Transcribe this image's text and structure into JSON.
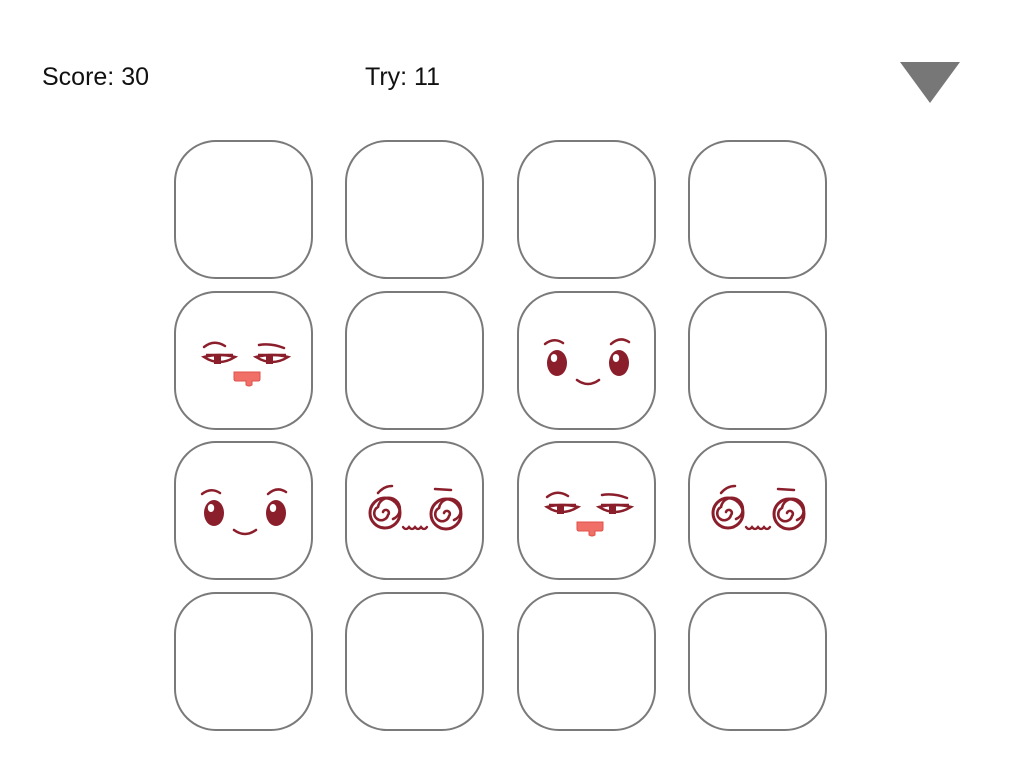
{
  "hud": {
    "score_label": "Score: 30",
    "try_label": "Try: 11"
  },
  "menu": {
    "icon": "triangle-down-icon",
    "color": "#777777"
  },
  "colors": {
    "face_dark": "#8b1e2b",
    "tongue": "#f07068",
    "card_border": "#7a7a7a"
  },
  "board": {
    "rows": 4,
    "cols": 4,
    "cards": [
      {
        "state": "hidden",
        "face": ""
      },
      {
        "state": "hidden",
        "face": ""
      },
      {
        "state": "hidden",
        "face": ""
      },
      {
        "state": "hidden",
        "face": ""
      },
      {
        "state": "revealed",
        "face": "smirk-tongue"
      },
      {
        "state": "hidden",
        "face": ""
      },
      {
        "state": "revealed",
        "face": "happy-smile"
      },
      {
        "state": "hidden",
        "face": ""
      },
      {
        "state": "revealed",
        "face": "happy-smile"
      },
      {
        "state": "revealed",
        "face": "dizzy-spiral"
      },
      {
        "state": "revealed",
        "face": "smirk-tongue"
      },
      {
        "state": "revealed",
        "face": "dizzy-spiral"
      },
      {
        "state": "hidden",
        "face": ""
      },
      {
        "state": "hidden",
        "face": ""
      },
      {
        "state": "hidden",
        "face": ""
      },
      {
        "state": "hidden",
        "face": ""
      }
    ]
  }
}
